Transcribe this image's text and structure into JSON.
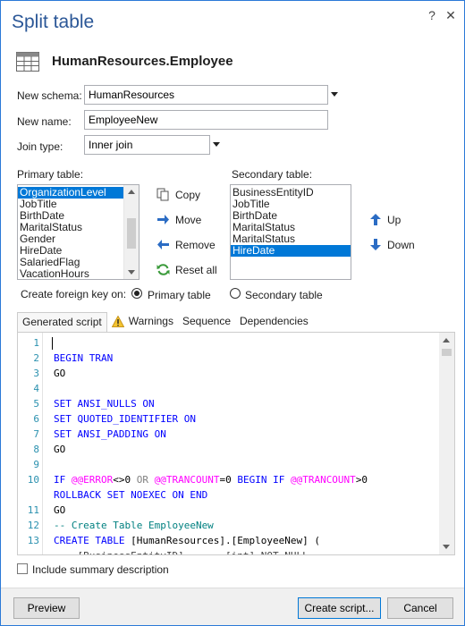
{
  "window": {
    "title": "Split table",
    "help_glyph": "?",
    "close_glyph": "✕",
    "accent_color": "#2b79d7"
  },
  "header": {
    "table_name": "HumanResources.Employee",
    "icon": "table-icon"
  },
  "form": {
    "new_schema_label": "New schema:",
    "new_schema_value": "HumanResources",
    "new_name_label": "New name:",
    "new_name_value": "EmployeeNew",
    "join_type_label": "Join type:",
    "join_type_value": "Inner join"
  },
  "primary_table": {
    "label": "Primary table:",
    "items": [
      "OrganizationLevel",
      "JobTitle",
      "BirthDate",
      "MaritalStatus",
      "Gender",
      "HireDate",
      "SalariedFlag",
      "VacationHours"
    ],
    "selected_index": 0
  },
  "secondary_table": {
    "label": "Secondary table:",
    "items": [
      "BusinessEntityID",
      "JobTitle",
      "BirthDate",
      "MaritalStatus",
      "MaritalStatus",
      "HireDate"
    ],
    "selected_index": 5
  },
  "actions": {
    "copy": "Copy",
    "move": "Move",
    "remove": "Remove",
    "reset_all": "Reset all",
    "up": "Up",
    "down": "Down"
  },
  "foreign_key": {
    "label": "Create foreign key on:",
    "primary_option": "Primary table",
    "secondary_option": "Secondary table",
    "selected": "primary"
  },
  "tabs": [
    {
      "label": "Generated script",
      "active": true
    },
    {
      "label": "Warnings",
      "active": false
    },
    {
      "label": "Sequence",
      "active": false
    },
    {
      "label": "Dependencies",
      "active": false
    }
  ],
  "script": {
    "line_numbers": [
      "1",
      "2",
      "3",
      "4",
      "5",
      "6",
      "7",
      "8",
      "9",
      "10",
      "11",
      "12",
      "13"
    ],
    "l2_kw": "BEGIN TRAN",
    "l3": "GO",
    "l5_kw": "SET ANSI_NULLS ON",
    "l6_kw": "SET QUOTED_IDENTIFIER ON",
    "l7_kw": "SET ANSI_PADDING ON",
    "l8": "GO",
    "l10_a": "IF ",
    "l10_b": "@@ERROR",
    "l10_c": "<>0 ",
    "l10_d": "OR ",
    "l10_e": "@@TRANCOUNT",
    "l10_f": "=0 ",
    "l10_g": "BEGIN IF ",
    "l10_h": "@@TRANCOUNT",
    "l10_i": ">0",
    "l10_wrap": "ROLLBACK SET NOEXEC ON END",
    "l11": "GO",
    "l12_cm": "-- Create Table EmployeeNew",
    "l13_kw": "CREATE TABLE ",
    "l13_rest": "[HumanResources].[EmployeeNew] (",
    "l14_partial": "    [BusinessEntityID]       [int] NOT NULL"
  },
  "include_summary_label": "Include summary description",
  "buttons": {
    "preview": "Preview",
    "create_script": "Create script...",
    "cancel": "Cancel"
  }
}
